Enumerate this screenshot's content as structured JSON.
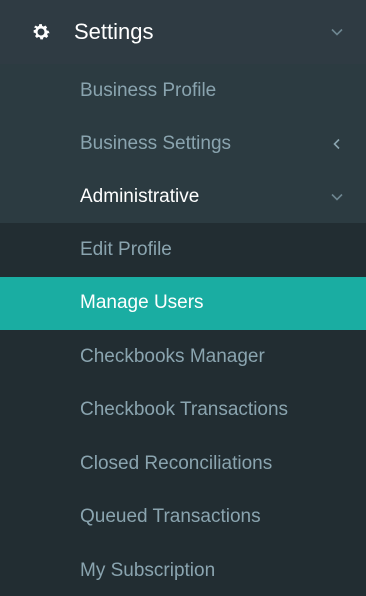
{
  "menu": {
    "settings": {
      "label": "Settings",
      "icon": "gear-icon",
      "expand_icon": "chevron-down-icon"
    },
    "sub_items": [
      {
        "label": "Business Profile"
      },
      {
        "label": "Business Settings",
        "icon": "chevron-left-icon"
      },
      {
        "label": "Administrative",
        "icon": "chevron-down-icon"
      }
    ],
    "admin_items": [
      {
        "label": "Edit Profile",
        "active": false
      },
      {
        "label": "Manage Users",
        "active": true
      },
      {
        "label": "Checkbooks Manager",
        "active": false
      },
      {
        "label": "Checkbook Transactions",
        "active": false
      },
      {
        "label": "Closed Reconciliations",
        "active": false
      },
      {
        "label": "Queued Transactions",
        "active": false
      },
      {
        "label": "My Subscription",
        "active": false
      }
    ],
    "colors": {
      "active_bg": "#1aada2",
      "text_muted": "#8aa4af",
      "text_active": "#ffffff"
    }
  }
}
